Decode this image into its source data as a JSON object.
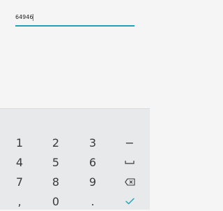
{
  "input": {
    "value": "64946"
  },
  "keyboard": {
    "rows": [
      [
        "1",
        "2",
        "3",
        "−"
      ],
      [
        "4",
        "5",
        "6",
        "space-icon"
      ],
      [
        "7",
        "8",
        "9",
        "backspace-icon"
      ],
      [
        ",",
        "0",
        ".",
        "check-icon"
      ]
    ],
    "accent_color": "#1aa3b8"
  }
}
